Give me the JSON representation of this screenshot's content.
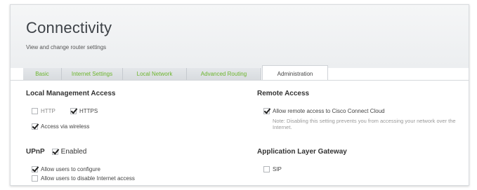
{
  "header": {
    "title": "Connectivity",
    "subtitle": "View and change router settings"
  },
  "tabs": [
    {
      "label": "Basic",
      "active": false
    },
    {
      "label": "Internet Settings",
      "active": false
    },
    {
      "label": "Local Network",
      "active": false
    },
    {
      "label": "Advanced Routing",
      "active": false
    },
    {
      "label": "Administration",
      "active": true
    }
  ],
  "local_management": {
    "title": "Local Management Access",
    "http_label": "HTTP",
    "http_checked": false,
    "https_label": "HTTPS",
    "https_checked": true,
    "wireless_label": "Access via wireless",
    "wireless_checked": true
  },
  "upnp": {
    "title": "UPnP",
    "enabled_label": "Enabled",
    "enabled_checked": true,
    "allow_configure_label": "Allow users to configure",
    "allow_configure_checked": true,
    "allow_disable_label": "Allow users to disable Internet access",
    "allow_disable_checked": false
  },
  "remote_access": {
    "title": "Remote Access",
    "allow_label": "Allow remote access to Cisco Connect Cloud",
    "allow_checked": true,
    "note": "Note: Disabling this setting prevents you from accessing your network over the Internet."
  },
  "alg": {
    "title": "Application Layer Gateway",
    "sip_label": "SIP",
    "sip_checked": false
  },
  "colors": {
    "tab_text": "#6cb52d",
    "active_tab_text": "#444444"
  }
}
